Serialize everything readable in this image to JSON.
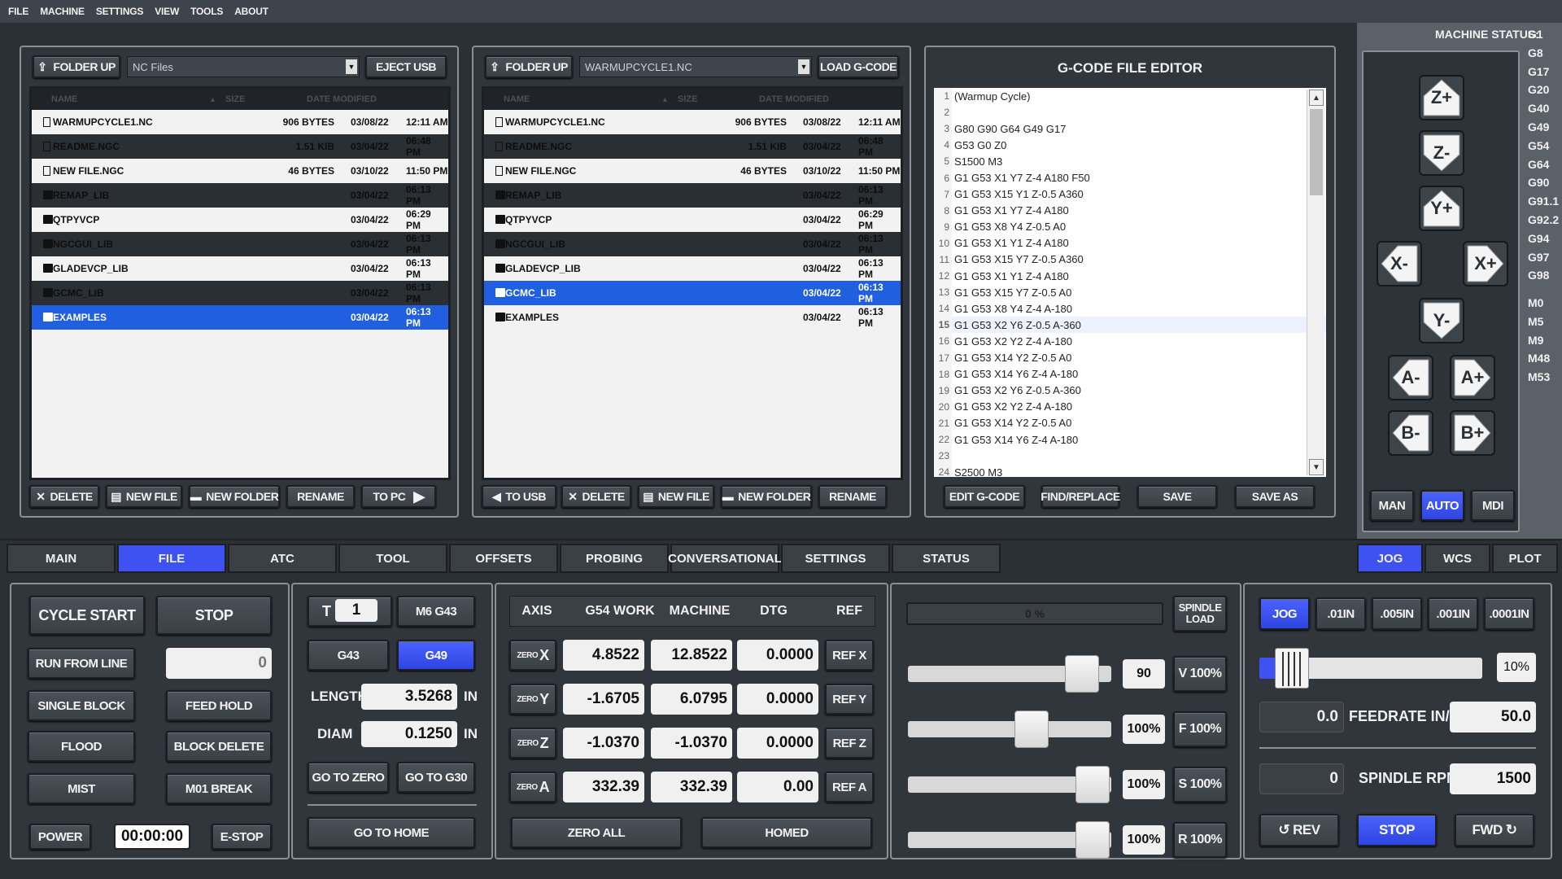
{
  "menu": [
    "FILE",
    "MACHINE",
    "SETTINGS",
    "VIEW",
    "TOOLS",
    "ABOUT"
  ],
  "left_browser": {
    "folder_up": "FOLDER UP",
    "combo": "NC Files",
    "eject": "EJECT USB",
    "headers": {
      "name": "NAME",
      "size": "SIZE",
      "date": "DATE MODIFIED"
    },
    "rows": [
      {
        "name": "WARMUPCYCLE1.NC",
        "size": "906 BYTES",
        "date": "03/08/22",
        "time": "12:11 AM",
        "type": "file",
        "style": "light"
      },
      {
        "name": "README.NGC",
        "size": "1.51 KIB",
        "date": "03/04/22",
        "time": "06:48 PM",
        "type": "file",
        "style": "dark"
      },
      {
        "name": "NEW FILE.NGC",
        "size": "46 BYTES",
        "date": "03/10/22",
        "time": "11:50 PM",
        "type": "file",
        "style": "light"
      },
      {
        "name": "REMAP_LIB",
        "size": "",
        "date": "03/04/22",
        "time": "06:13 PM",
        "type": "folder",
        "style": "dark"
      },
      {
        "name": "QTPYVCP",
        "size": "",
        "date": "03/04/22",
        "time": "06:29 PM",
        "type": "folder",
        "style": "light"
      },
      {
        "name": "NGCGUI_LIB",
        "size": "",
        "date": "03/04/22",
        "time": "06:13 PM",
        "type": "folder",
        "style": "dark"
      },
      {
        "name": "GLADEVCP_LIB",
        "size": "",
        "date": "03/04/22",
        "time": "06:13 PM",
        "type": "folder",
        "style": "light"
      },
      {
        "name": "GCMC_LIB",
        "size": "",
        "date": "03/04/22",
        "time": "06:13 PM",
        "type": "folder",
        "style": "dark"
      },
      {
        "name": "EXAMPLES",
        "size": "",
        "date": "03/04/22",
        "time": "06:13 PM",
        "type": "folder",
        "style": "sel"
      }
    ],
    "buttons": [
      "DELETE",
      "NEW FILE",
      "NEW FOLDER",
      "RENAME",
      "TO PC"
    ]
  },
  "right_browser": {
    "folder_up": "FOLDER UP",
    "combo": "WARMUPCYCLE1.NC",
    "load": "LOAD G-CODE",
    "headers": {
      "name": "NAME",
      "size": "SIZE",
      "date": "DATE MODIFIED"
    },
    "rows": [
      {
        "name": "WARMUPCYCLE1.NC",
        "size": "906 BYTES",
        "date": "03/08/22",
        "time": "12:11 AM",
        "type": "file",
        "style": "light"
      },
      {
        "name": "README.NGC",
        "size": "1.51 KIB",
        "date": "03/04/22",
        "time": "06:48 PM",
        "type": "file",
        "style": "dark"
      },
      {
        "name": "NEW FILE.NGC",
        "size": "46 BYTES",
        "date": "03/10/22",
        "time": "11:50 PM",
        "type": "file",
        "style": "light"
      },
      {
        "name": "REMAP_LIB",
        "size": "",
        "date": "03/04/22",
        "time": "06:13 PM",
        "type": "folder",
        "style": "dark"
      },
      {
        "name": "QTPYVCP",
        "size": "",
        "date": "03/04/22",
        "time": "06:29 PM",
        "type": "folder",
        "style": "light"
      },
      {
        "name": "NGCGUI_LIB",
        "size": "",
        "date": "03/04/22",
        "time": "06:13 PM",
        "type": "folder",
        "style": "dark"
      },
      {
        "name": "GLADEVCP_LIB",
        "size": "",
        "date": "03/04/22",
        "time": "06:13 PM",
        "type": "folder",
        "style": "light"
      },
      {
        "name": "GCMC_LIB",
        "size": "",
        "date": "03/04/22",
        "time": "06:13 PM",
        "type": "folder",
        "style": "sel"
      },
      {
        "name": "EXAMPLES",
        "size": "",
        "date": "03/04/22",
        "time": "06:13 PM",
        "type": "folder",
        "style": "light"
      }
    ],
    "buttons": [
      "TO USB",
      "DELETE",
      "NEW FILE",
      "NEW FOLDER",
      "RENAME"
    ]
  },
  "editor": {
    "title": "G-CODE FILE EDITOR",
    "lines": [
      "(Warmup Cycle)",
      "",
      "G80 G90 G64 G49 G17",
      "G53 G0 Z0",
      "S1500 M3",
      "G1 G53 X1 Y7 Z-4 A180 F50",
      "G1 G53 X15 Y1 Z-0.5 A360",
      "G1 G53 X1 Y7 Z-4 A180",
      "G1 G53 X8 Y4 Z-0.5 A0",
      "G1 G53 X1 Y1 Z-4 A180",
      "G1 G53 X15 Y7 Z-0.5 A360",
      "G1 G53 X1 Y1 Z-4 A180",
      "G1 G53 X15 Y7 Z-0.5 A0",
      "G1 G53 X8 Y4 Z-4 A-180",
      "G1 G53 X2 Y6 Z-0.5 A-360",
      "G1 G53 X2 Y2 Z-4 A-180",
      "G1 G53 X14 Y2 Z-0.5 A0",
      "G1 G53 X14 Y6 Z-4 A-180",
      "G1 G53 X2 Y6 Z-0.5 A-360",
      "G1 G53 X2 Y2 Z-4 A-180",
      "G1 G53 X14 Y2 Z-0.5 A0",
      "G1 G53 X14 Y6 Z-4 A-180",
      "",
      "S2500 M3"
    ],
    "current_line": 15,
    "buttons": [
      "EDIT G-CODE",
      "FIND/REPLACE",
      "SAVE",
      "SAVE AS"
    ]
  },
  "status": {
    "label": "MACHINE STATUS:",
    "gcodes": [
      "G1",
      "G8",
      "G17",
      "G20",
      "G40",
      "G49",
      "G54",
      "G64",
      "G90",
      "G91.1",
      "G92.2",
      "G94",
      "G97",
      "G98"
    ],
    "mcodes": [
      "M0",
      "M5",
      "M9",
      "M48",
      "M53"
    ]
  },
  "jog_side": {
    "buttons": [
      "Z+",
      "Z-",
      "Y+",
      "X-",
      "X+",
      "Y-",
      "A-",
      "A+",
      "B-",
      "B+"
    ],
    "modes": [
      "MAN",
      "AUTO",
      "MDI"
    ],
    "active_mode": "AUTO"
  },
  "tabs": [
    "MAIN",
    "FILE",
    "ATC",
    "TOOL",
    "OFFSETS",
    "PROBING",
    "CONVERSATIONAL",
    "SETTINGS",
    "STATUS"
  ],
  "active_tab": "FILE",
  "right_tabs": [
    "JOG",
    "WCS",
    "PLOT"
  ],
  "active_right_tab": "JOG",
  "control": {
    "cycle_start": "CYCLE START",
    "stop": "STOP",
    "run_from_line": "RUN FROM LINE",
    "run_line_value": "0",
    "single_block": "SINGLE BLOCK",
    "feed_hold": "FEED HOLD",
    "flood": "FLOOD",
    "block_delete": "BLOCK DELETE",
    "mist": "MIST",
    "m01_break": "M01 BREAK",
    "power": "POWER",
    "timer": "00:00:00",
    "estop": "E-STOP"
  },
  "tool": {
    "t_label": "T",
    "t_value": "1",
    "m6g43": "M6 G43",
    "g43": "G43",
    "g49": "G49",
    "length_label": "LENGTH",
    "length_value": "3.5268",
    "diam_label": "DIAM",
    "diam_value": "0.1250",
    "unit": "IN",
    "go_zero": "GO TO ZERO",
    "go_g30": "GO TO G30",
    "go_home": "GO TO HOME"
  },
  "dro": {
    "headers": [
      "AXIS",
      "G54 WORK",
      "MACHINE",
      "DTG",
      "REF"
    ],
    "rows": [
      {
        "axis": "X",
        "zero": "ZERO",
        "work": "4.8522",
        "machine": "12.8522",
        "dtg": "0.0000",
        "ref": "REF X"
      },
      {
        "axis": "Y",
        "zero": "ZERO",
        "work": "-1.6705",
        "machine": "6.0795",
        "dtg": "0.0000",
        "ref": "REF Y"
      },
      {
        "axis": "Z",
        "zero": "ZERO",
        "work": "-1.0370",
        "machine": "-1.0370",
        "dtg": "0.0000",
        "ref": "REF Z"
      },
      {
        "axis": "A",
        "zero": "ZERO",
        "work": "332.39",
        "machine": "332.39",
        "dtg": "0.00",
        "ref": "REF A"
      }
    ],
    "zero_all": "ZERO ALL",
    "homed": "HOMED"
  },
  "overrides": {
    "load_pct": "0 %",
    "spindle_load": "SPINDLE LOAD",
    "rows": [
      {
        "value": "90",
        "btn": "V 100%",
        "level": 0.93
      },
      {
        "value": "100%",
        "btn": "F 100%",
        "level": 0.63
      },
      {
        "value": "100%",
        "btn": "S 100%",
        "level": 0.99
      },
      {
        "value": "100%",
        "btn": "R 100%",
        "level": 0.99
      }
    ]
  },
  "jog_panel": {
    "increments": [
      "JOG",
      ".01IN",
      ".005IN",
      ".001IN",
      ".0001IN"
    ],
    "active": "JOG",
    "jog_pct": "10%",
    "feed_value": "0.0",
    "feed_label": "FEEDRATE IN/M",
    "feed_set": "50.0",
    "rpm_value": "0",
    "rpm_label": "SPINDLE RPM",
    "rpm_set": "1500",
    "rev": "REV",
    "stop": "STOP",
    "fwd": "FWD"
  }
}
